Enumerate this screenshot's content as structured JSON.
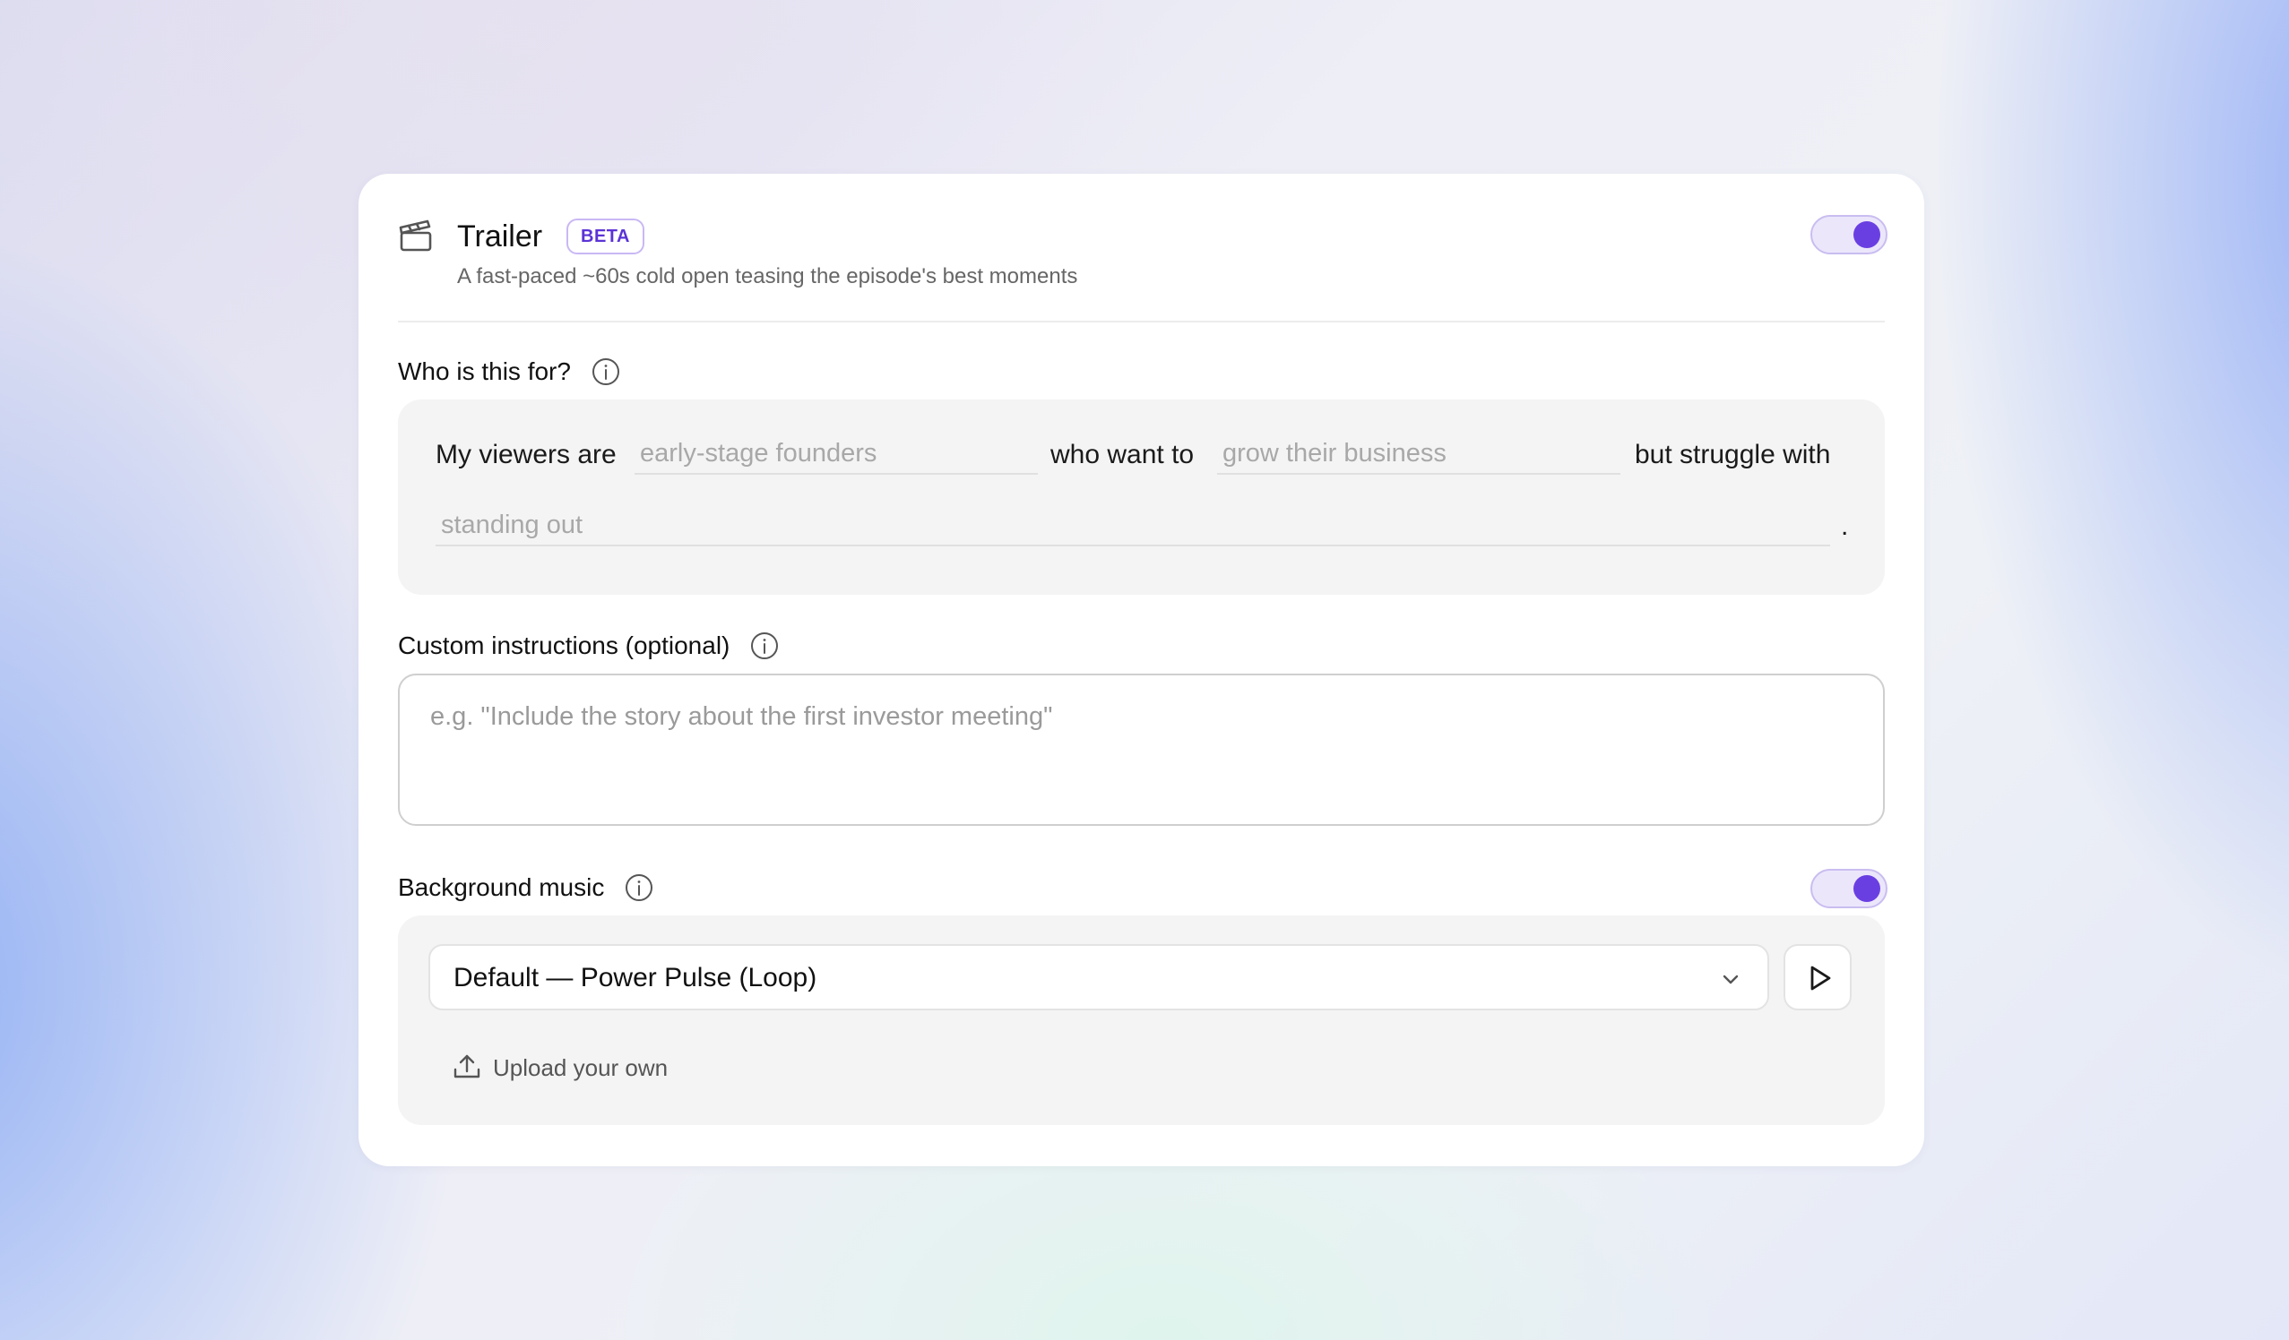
{
  "trailer": {
    "title": "Trailer",
    "badge": "BETA",
    "subtitle": "A fast-paced ~60s cold open teasing the episode's best moments",
    "enabled": true
  },
  "audience": {
    "label": "Who is this for?",
    "prefix": "My viewers are",
    "viewers_placeholder": "early-stage founders",
    "middle": "who want to",
    "goal_placeholder": "grow their business",
    "struggle_text": "but struggle with",
    "struggle_placeholder": "standing out",
    "period": "."
  },
  "instructions": {
    "label": "Custom instructions (optional)",
    "placeholder": "e.g. \"Include the story about the first investor meeting\""
  },
  "music": {
    "label": "Background music",
    "enabled": true,
    "selected": "Default — Power Pulse (Loop)",
    "upload_label": "Upload your own"
  },
  "colors": {
    "accent": "#6a3fe2",
    "toggle_track": "#ece6fb",
    "badge_text": "#5b33d6"
  }
}
